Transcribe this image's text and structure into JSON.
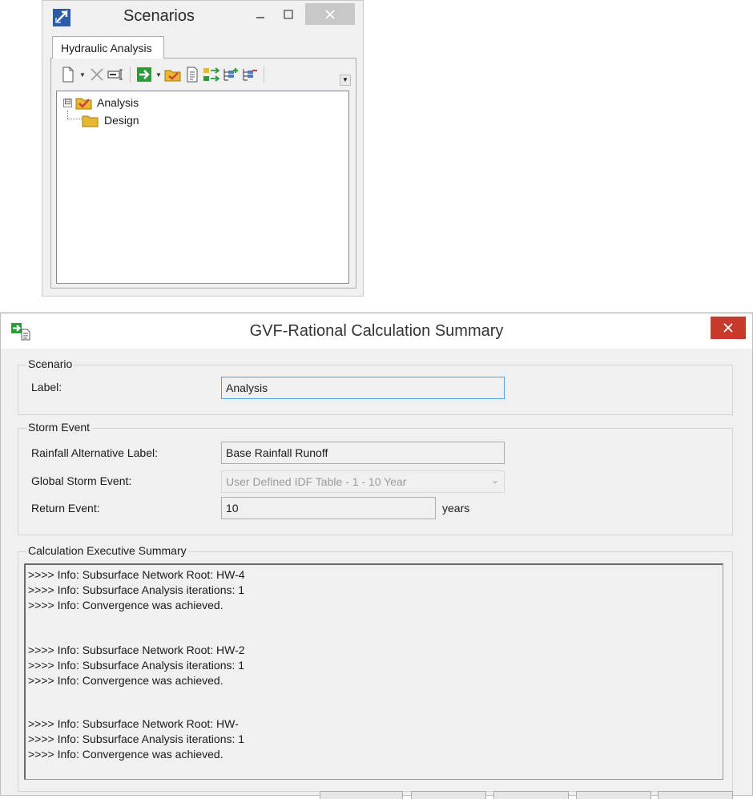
{
  "scenarios_window": {
    "title": "Scenarios",
    "tab_label": "Hydraulic Analysis",
    "toolbar_icons": [
      "new-icon",
      "delete-icon",
      "rename-icon",
      "compute-icon",
      "make-current-icon",
      "report-icon",
      "compare-icon",
      "expand-icon",
      "collapse-icon"
    ],
    "tree": [
      {
        "label": "Analysis",
        "expander": "⊟",
        "icon": "current-scenario-icon"
      },
      {
        "label": "Design",
        "icon": "folder-icon"
      }
    ]
  },
  "calc_dialog": {
    "title": "GVF-Rational Calculation Summary",
    "scenario_group": {
      "legend": "Scenario",
      "label_caption": "Label:",
      "label_value": "Analysis"
    },
    "storm_group": {
      "legend": "Storm Event",
      "rainfall_caption": "Rainfall Alternative Label:",
      "rainfall_value": "Base Rainfall Runoff",
      "global_caption": "Global Storm Event:",
      "global_value": "User Defined IDF Table - 1 - 10 Year",
      "return_caption": "Return Event:",
      "return_value": "10",
      "return_unit": "years"
    },
    "summary_group": {
      "legend": "Calculation Executive Summary",
      "lines": [
        ">>>> Info: Subsurface Network Root: HW-4",
        ">>>> Info: Subsurface Analysis iterations: 1",
        ">>>> Info: Convergence was achieved.",
        "",
        "",
        ">>>> Info: Subsurface Network Root: HW-2",
        ">>>> Info: Subsurface Analysis iterations: 1",
        ">>>> Info: Convergence was achieved.",
        "",
        "",
        ">>>> Info: Subsurface Network Root: HW-",
        ">>>> Info: Subsurface Analysis iterations: 1",
        ">>>> Info: Convergence was achieved."
      ]
    }
  },
  "colors": {
    "close_button": "#c7392b",
    "focus_border": "#569de5",
    "dialog_bg": "#f0f0f0",
    "scenario_icon": "#d04040",
    "folder_icon": "#e8b830",
    "compute_icon": "#2e9a3a"
  }
}
